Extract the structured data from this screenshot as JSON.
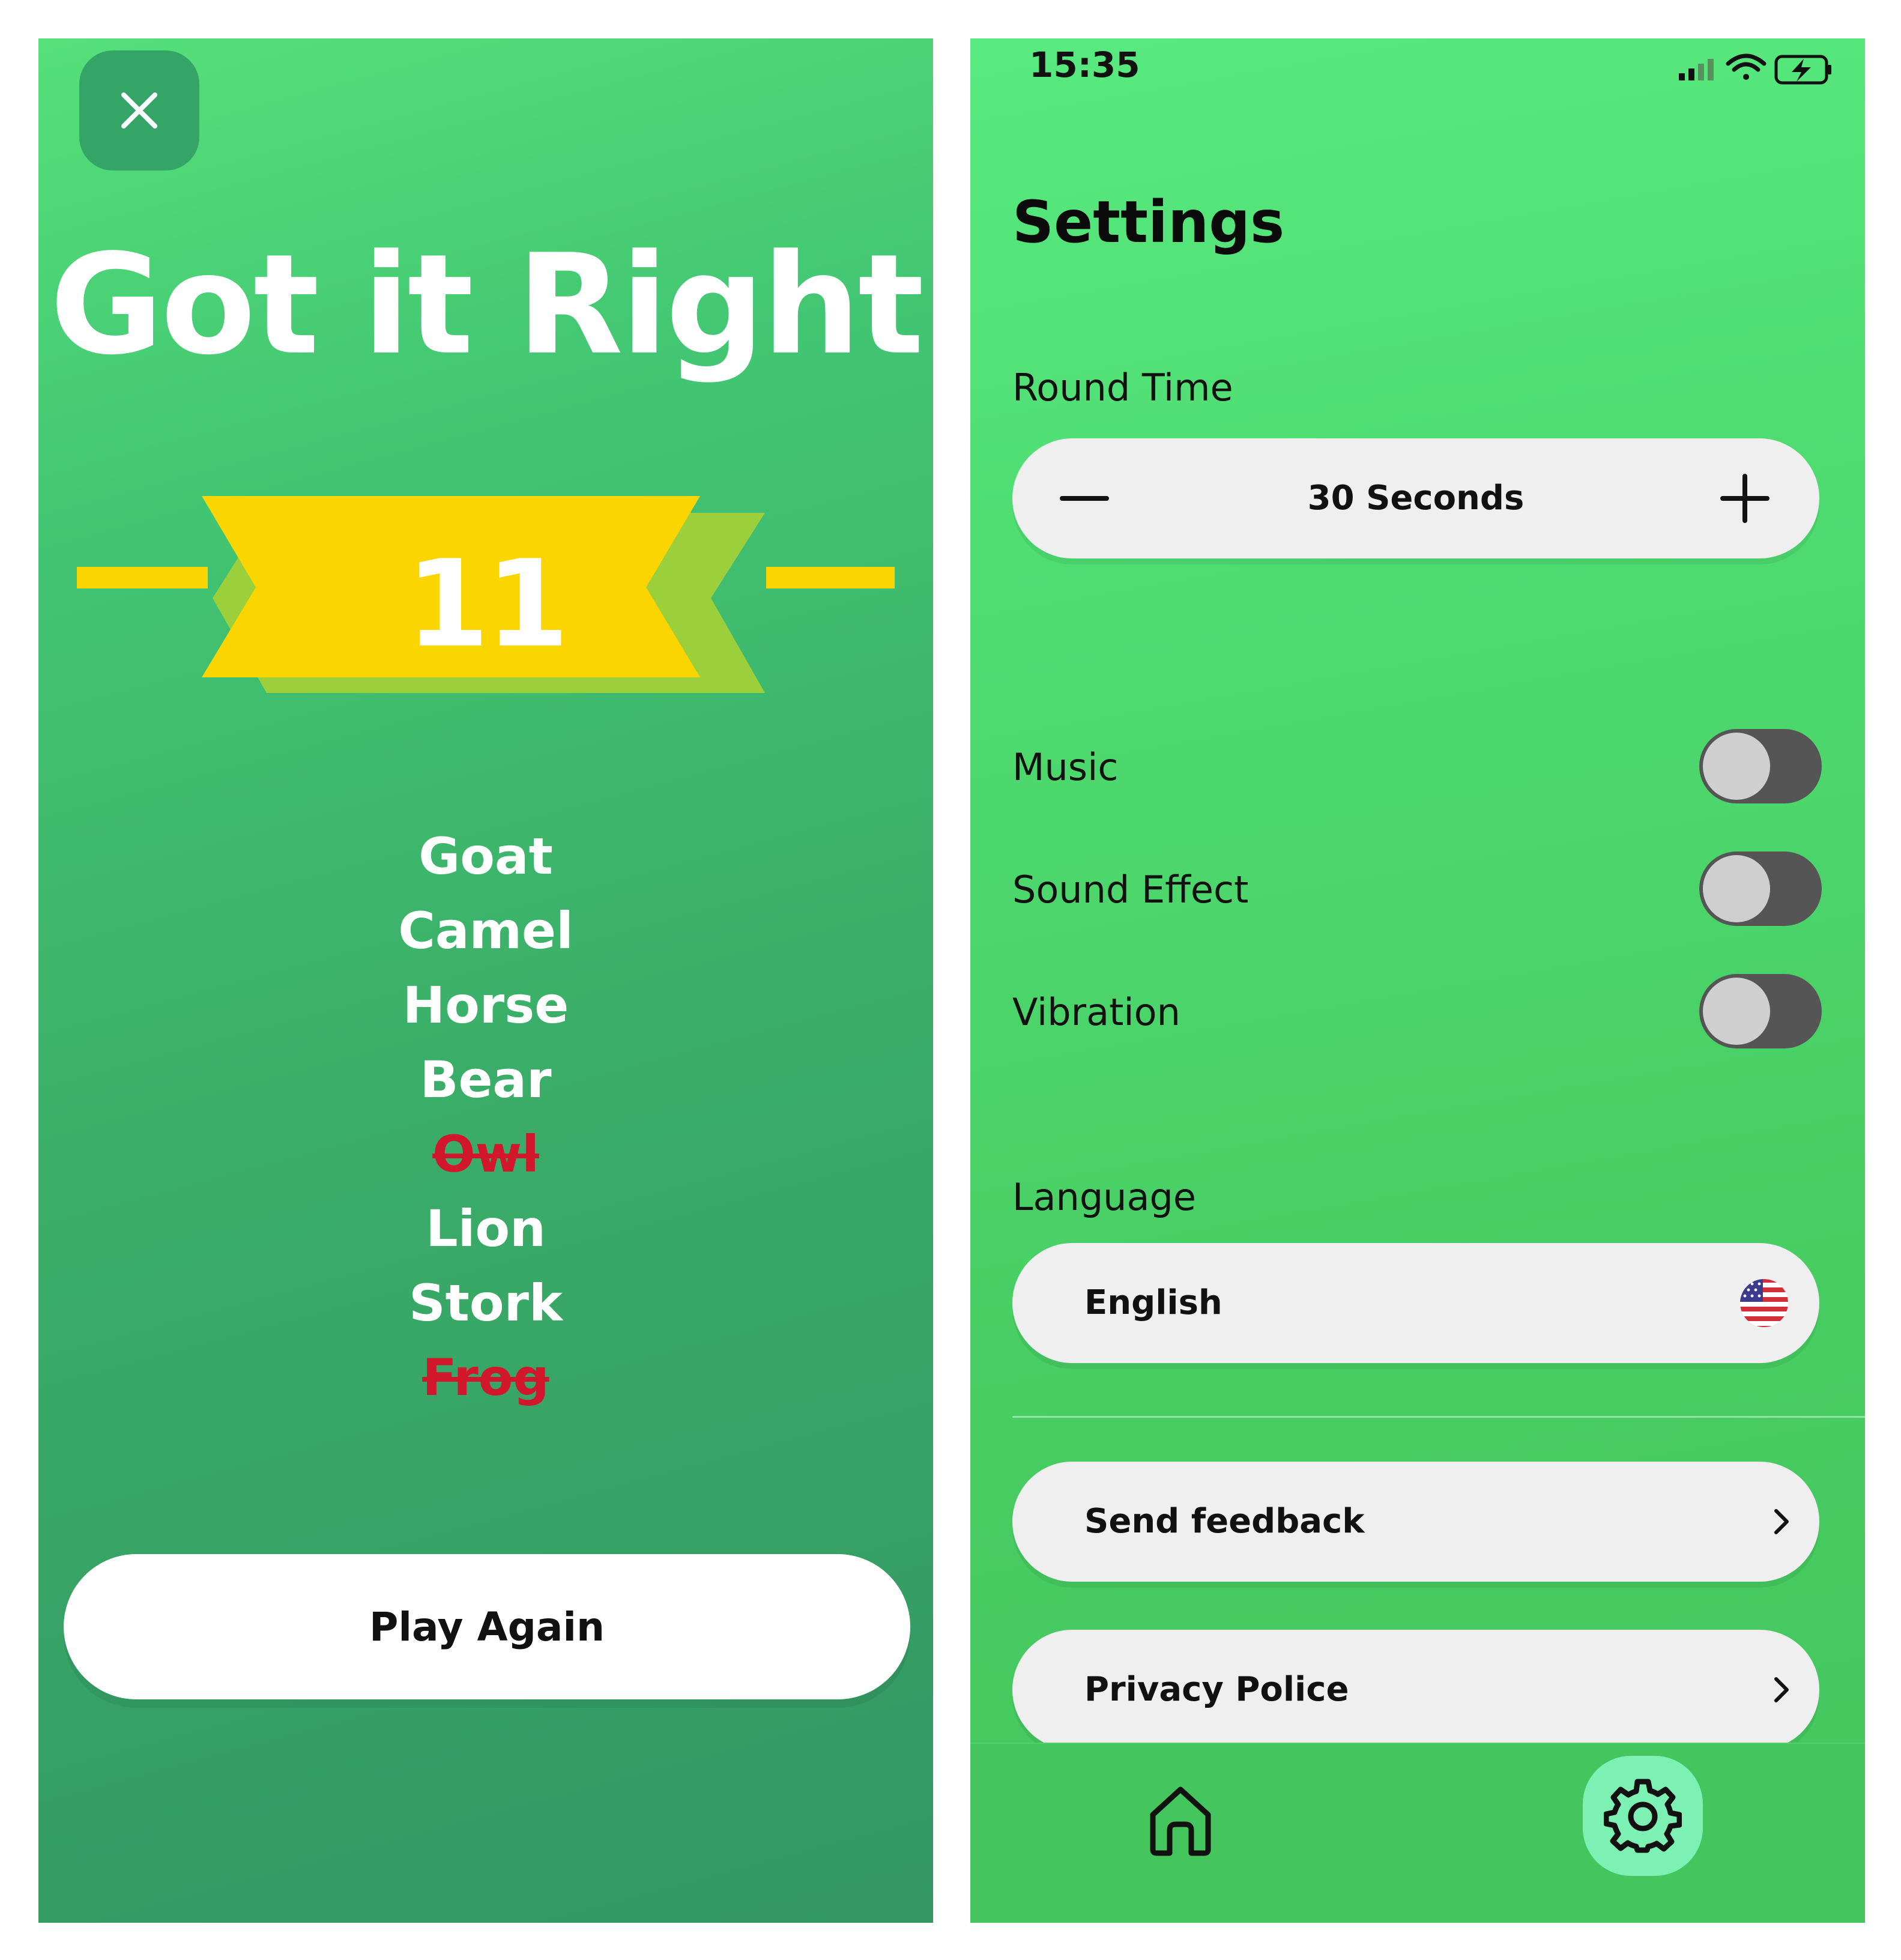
{
  "result_screen": {
    "title": "Got it Right",
    "score": "11",
    "words": [
      {
        "text": "Goat",
        "guessed": true
      },
      {
        "text": "Camel",
        "guessed": true
      },
      {
        "text": "Horse",
        "guessed": true
      },
      {
        "text": "Bear",
        "guessed": true
      },
      {
        "text": "Owl",
        "guessed": false
      },
      {
        "text": "Lion",
        "guessed": true
      },
      {
        "text": "Stork",
        "guessed": true
      },
      {
        "text": "Frog",
        "guessed": false
      }
    ],
    "play_again_label": "Play Again",
    "colors": {
      "ribbon": "#fbd500",
      "missed_word": "#d2172d",
      "close_button": "#34a567"
    }
  },
  "settings_screen": {
    "status_time": "15:35",
    "title": "Settings",
    "round_time": {
      "label": "Round Time",
      "value": "30 Seconds"
    },
    "toggles": [
      {
        "label": "Music",
        "on": false
      },
      {
        "label": "Sound Effect",
        "on": false
      },
      {
        "label": "Vibration",
        "on": false
      }
    ],
    "language": {
      "label": "Language",
      "value": "English",
      "flag_icon": "us-flag-icon"
    },
    "menu": [
      {
        "label": "Send feedback"
      },
      {
        "label": "Privacy Police"
      }
    ],
    "nav": {
      "items": [
        "home-icon",
        "gear-icon"
      ],
      "active": "gear-icon"
    },
    "colors": {
      "nav_active": "#7df0b4",
      "toggle_track": "#555555",
      "toggle_knob": "#cfcfcf"
    }
  }
}
